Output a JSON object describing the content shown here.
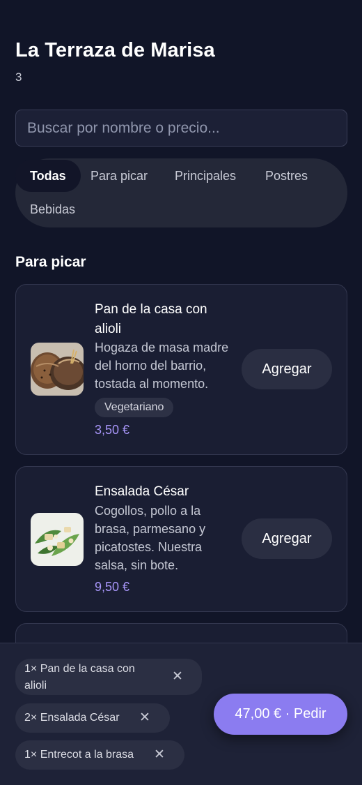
{
  "header": {
    "title": "La Terraza de Marisa",
    "count": "3"
  },
  "search": {
    "placeholder": "Buscar por nombre o precio..."
  },
  "filters": [
    "Todas",
    "Para picar",
    "Principales",
    "Postres",
    "Bebidas"
  ],
  "section": {
    "title": "Para picar"
  },
  "items": [
    {
      "name": "Pan de la casa con alioli",
      "description": "Hogaza de masa madre del horno del barrio, tostada al momento.",
      "tag": "Vegetariano",
      "price": "3,50 €",
      "button": "Agregar",
      "image_icon": "bread-icon"
    },
    {
      "name": "Ensalada César",
      "description": "Cogollos, pollo a la brasa, parmesano y picatostes. Nuestra salsa, sin bote.",
      "price": "9,50 €",
      "button": "Agregar",
      "image_icon": "salad-icon"
    }
  ],
  "cart": {
    "items": [
      "1× Pan de la casa con alioli",
      "2× Ensalada César",
      "1× Entrecot a la brasa"
    ],
    "remove_symbol": "✕",
    "order_label": "47,00 € · Pedir"
  },
  "colors": {
    "background": "#111528",
    "accent": "#8b7cf0",
    "price": "#a795f8"
  }
}
